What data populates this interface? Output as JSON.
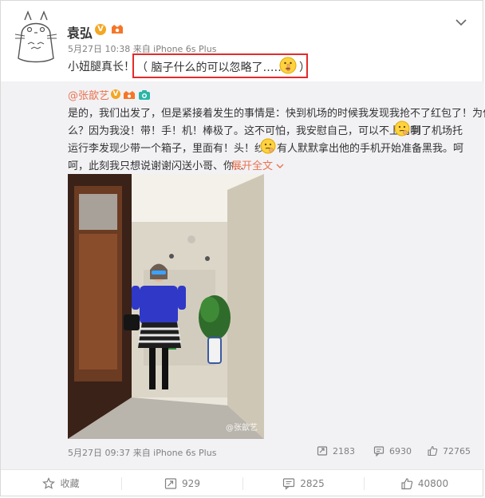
{
  "post": {
    "user_name": "袁弘",
    "verified_mark": "V",
    "meta": "5月27日 10:38 来自 iPhone 6s Plus",
    "text": "小妞腿真长！",
    "highlight_text": "（ 脑子什么的可以忽略了……",
    "highlight_close": "）"
  },
  "retweet": {
    "handle": "@张歆艺",
    "verified_mark": "V",
    "lines": [
      "是的，我们出发了，但是紧接着发生的事情是：快到机场的时候我发现我抢不了红包了！为什",
      "么？因为我没！带！手！机！棒极了。这不可怕，我安慰自己，可以不上网啊",
      "到了机场托",
      "运行李发现少带一个箱子，里面有！头！纱！",
      "有人默默拿出他的手机开始准备黑我。呵",
      "呵，此刻我只想说谢谢闪送小哥、你..."
    ],
    "expand_label": "展开全文",
    "watermark": "@张歆艺",
    "meta": "5月27日 09:37 来自 iPhone 6s Plus",
    "stats": {
      "reposts": "2183",
      "comments": "6930",
      "likes": "72765"
    }
  },
  "actions": {
    "favorite": "收藏",
    "repost": "929",
    "comment": "2825",
    "like": "40800"
  },
  "colors": {
    "accent_link": "#eb7350",
    "highlight_border": "#e42b2b",
    "muted": "#808080",
    "retweet_bg": "#f2f2f5"
  }
}
